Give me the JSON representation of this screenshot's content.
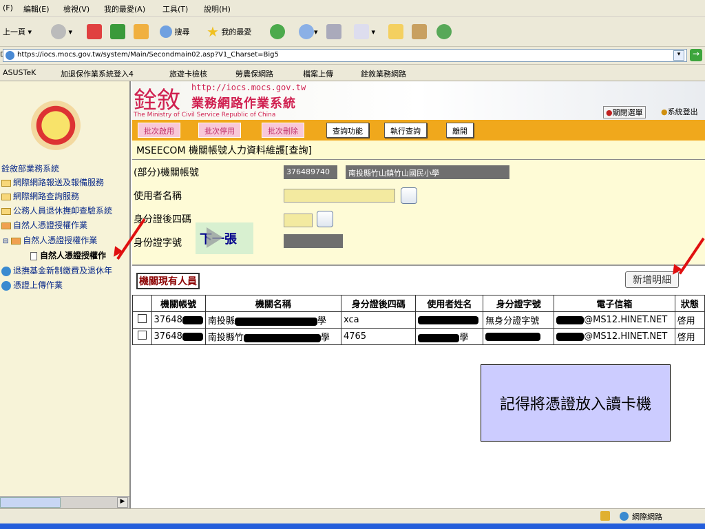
{
  "menu": [
    "(F)",
    "編輯(E)",
    "檢視(V)",
    "我的最愛(A)",
    "工具(T)",
    "說明(H)"
  ],
  "toolbar": {
    "back": "上一頁",
    "search": "搜尋",
    "favorites": "我的最愛"
  },
  "address": {
    "prefix": "D)",
    "url": "https://iocs.mocs.gov.tw/system/Main/Secondmain02.asp?V1_Charset=Big5"
  },
  "links": [
    "ASUSTeK",
    "加退保作業系統登入4",
    "旅遊卡檢核",
    "勞農保網路",
    "檔案上傳",
    "銓敘業務網路"
  ],
  "sidebar": {
    "root": "銓敘部業務系統",
    "items": [
      "網際網路報送及報備服務",
      "網際網路查詢服務",
      "公務人員退休撫卹查驗系統",
      "自然人憑證授權作業",
      "自然人憑證授權作業",
      "自然人憑證授權作",
      "退撫基金新制繳費及退休年",
      "憑證上傳作業"
    ]
  },
  "banner": {
    "title_logo": "銓敘",
    "url": "http://iocs.mocs.gov.tw",
    "system_name": "業務網路作業系統",
    "subtitle": "The Ministry of Civil Service Republic of China",
    "close_menu": "關閉選單",
    "login": "系統登出"
  },
  "buttons": {
    "batch_enable": "批次啟用",
    "batch_disable": "批次停用",
    "batch_delete": "批次刪除",
    "query_func": "查詢功能",
    "execute_query": "執行查詢",
    "leave": "離開"
  },
  "page_title": "MSEECOM 機關帳號人力資料維護[查詢]",
  "form": {
    "agency_label": "(部分)機關帳號",
    "agency_code": "376489740",
    "agency_name": "南投縣竹山鎮竹山國民小學",
    "username_label": "使用者名稱",
    "id_last4_label": "身分證後四碼",
    "id_char_label": "身份證字號",
    "next_button": "下一張"
  },
  "table": {
    "section_title": "機關現有人員",
    "add_detail": "新增明細",
    "columns": [
      "機關帳號",
      "機關名稱",
      "身分證後四碼",
      "使用者姓名",
      "身分證字號",
      "電子信箱",
      "狀態"
    ],
    "rows": [
      {
        "account": "37648",
        "name": "南投縣",
        "name_tail": "學",
        "last4": "xca",
        "user": "",
        "idno": "無身分證字號",
        "email": "@MS12.HINET.NET",
        "status": "啓用"
      },
      {
        "account": "37648",
        "name": "南投縣竹",
        "name_tail": "學",
        "last4": "4765",
        "user": "學",
        "idno": "",
        "email": "@MS12.HINET.NET",
        "status": "啓用"
      }
    ]
  },
  "note": "記得將憑證放入讀卡機",
  "status": {
    "zone": "網際網路"
  }
}
